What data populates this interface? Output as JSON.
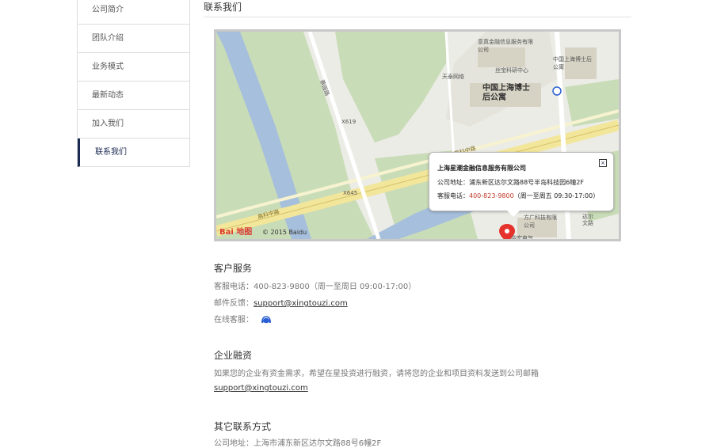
{
  "sidebar": {
    "items": [
      {
        "label": "公司简介"
      },
      {
        "label": "团队介绍"
      },
      {
        "label": "业务模式"
      },
      {
        "label": "最新动态"
      },
      {
        "label": "加入我们"
      },
      {
        "label": "联系我们"
      }
    ]
  },
  "page": {
    "title": "联系我们"
  },
  "map": {
    "infobox": {
      "title": "上海星潮金融信息服务有限公司",
      "address_label": "公司地址：",
      "address": "浦东新区达尔文路88号半岛科技园6幢2F",
      "phone_label": "客服电话：",
      "phone": "400-823-9800",
      "hours": "（周一至周五 09:30-17:00）",
      "close": "×"
    },
    "logo": "Bai 地图",
    "copyright": "© 2015 Baidu",
    "labels": {
      "poi_1": "意真金融信息服务有限公司",
      "poi_2": "天泰网络",
      "poi_3": "丝宝科研中心",
      "poi_4": "中国上海博士后公寓",
      "poi_big": "中国上海博士后公寓",
      "poi_5": "方广科技有限公司",
      "poi_6": "华宏电气",
      "road_1": "高科中路",
      "road_2": "高科中路",
      "road_3": "X645",
      "road_4": "X619",
      "road_5": "达尔文路",
      "road_6": "蔡园路"
    }
  },
  "customer_service": {
    "title": "客户服务",
    "phone": "客服电话：400-823-9800（周一至周日 09:00-17:00）",
    "email_label": "邮件反馈：",
    "email": "support@xingtouzi.com",
    "online_label": "在线客服："
  },
  "financing": {
    "title": "企业融资",
    "text": "如果您的企业有资金需求，希望在星投资进行融资，请将您的企业和项目资料发送到公司邮箱",
    "email": "support@xingtouzi.com"
  },
  "other": {
    "title": "其它联系方式",
    "address": "公司地址：上海市浦东新区达尔文路88号6幢2F"
  }
}
